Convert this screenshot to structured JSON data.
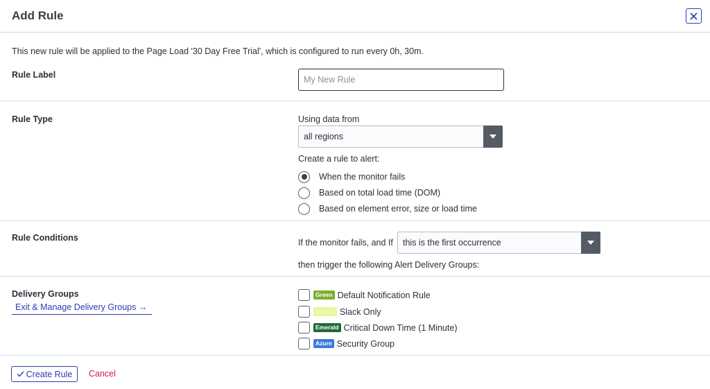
{
  "header": {
    "title": "Add Rule",
    "close_icon": "close-icon"
  },
  "intro_text": "This new rule will be applied to the Page Load '30 Day Free Trial', which is configured to run every 0h, 30m.",
  "rule_label": {
    "label": "Rule Label",
    "input_value": "",
    "placeholder": "My New Rule"
  },
  "rule_type": {
    "label": "Rule Type",
    "data_source_label": "Using data from",
    "data_source_value": "all regions",
    "alert_prompt": "Create a rule to alert:",
    "options": [
      {
        "label": "When the monitor fails",
        "selected": true
      },
      {
        "label": "Based on total load time (DOM)",
        "selected": false
      },
      {
        "label": "Based on element error, size or load time",
        "selected": false
      }
    ]
  },
  "rule_conditions": {
    "label": "Rule Conditions",
    "prefix": "If the monitor fails, and If",
    "condition_value": "this is the first occurrence",
    "suffix": "then trigger the following Alert Delivery Groups:"
  },
  "delivery_groups": {
    "label": "Delivery Groups",
    "manage_link": "Exit & Manage Delivery Groups →",
    "groups": [
      {
        "badge": "Green",
        "badge_color": "#7cad2e",
        "badge_text_color": "#ffffff",
        "name": "Default Notification Rule",
        "checked": false
      },
      {
        "badge": "Lemon",
        "badge_color": "#e9f59a",
        "badge_text_color": "#f4f7c8",
        "name": "Slack Only",
        "checked": false
      },
      {
        "badge": "Emerald",
        "badge_color": "#1f6b3a",
        "badge_text_color": "#ffffff",
        "name": "Critical Down Time (1 Minute)",
        "checked": false
      },
      {
        "badge": "Azure",
        "badge_color": "#3d7bdc",
        "badge_text_color": "#ffffff",
        "name": "Security Group",
        "checked": false
      }
    ]
  },
  "footer": {
    "create_label": "Create Rule",
    "create_icon": "check-icon",
    "cancel_label": "Cancel"
  },
  "colors": {
    "accent": "#2f3ab5",
    "cancel": "#d0184f",
    "divider": "#cfdbe8"
  }
}
